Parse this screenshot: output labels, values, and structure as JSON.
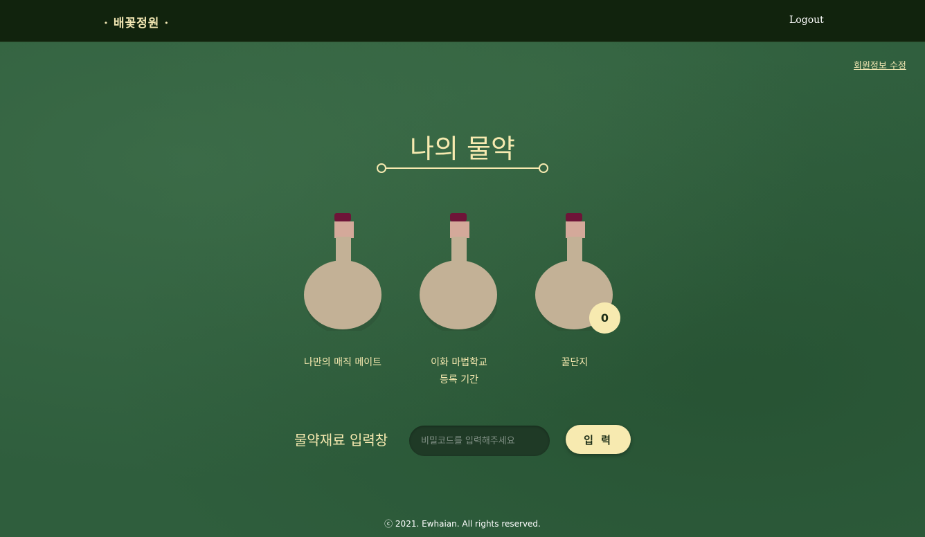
{
  "header": {
    "brand": "· 배꽃정원 ·",
    "logout_label": "Logout"
  },
  "profile_edit_link": "회원정보 수정",
  "page_title": "나의 물약",
  "potions": [
    {
      "label": "나만의 매직 메이트",
      "icon": "potion-bottle-icon"
    },
    {
      "label_line1": "이화 마법학교",
      "label_line2": "등록 기간",
      "icon": "potion-bottle-icon"
    },
    {
      "label": "꿀단지",
      "icon": "potion-bottle-icon",
      "count": "0"
    }
  ],
  "ingredient_input": {
    "label": "물약재료 입력창",
    "placeholder": "비밀코드를 입력해주세요",
    "value": "",
    "submit_label": "입 력"
  },
  "footer": "ⓒ 2021. Ewhaian. All rights reserved.",
  "colors": {
    "topbar": "#11230d",
    "background": "#2f5e3d",
    "accent": "#f7eab0",
    "bottle_body": "#c3b196",
    "bottle_cork": "#6e1438",
    "bottle_neck": "#d4a99a"
  }
}
